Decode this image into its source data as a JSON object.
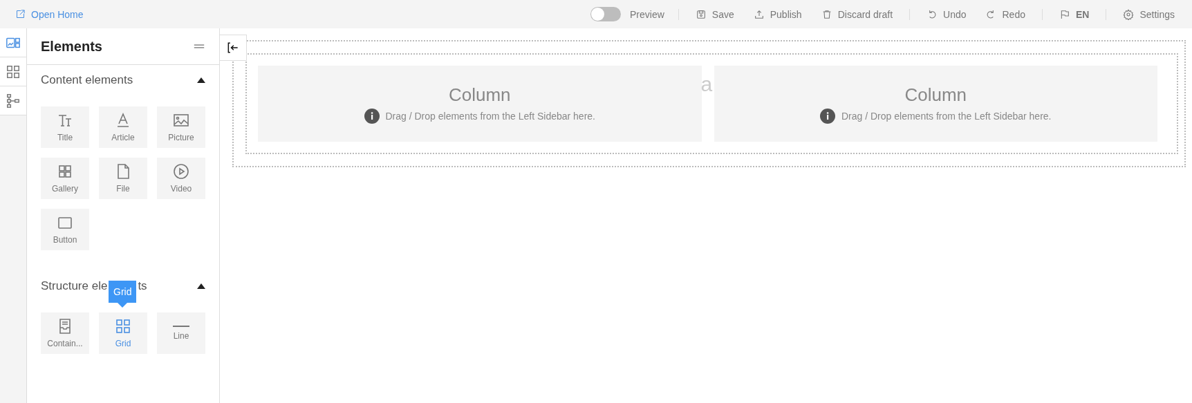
{
  "header": {
    "open_home": "Open Home",
    "groups": [
      [
        {
          "kind": "toggle",
          "label": "Preview",
          "on": false
        }
      ],
      [
        {
          "kind": "save",
          "label": "Save"
        },
        {
          "kind": "publish",
          "label": "Publish"
        },
        {
          "kind": "trash",
          "label": "Discard draft"
        }
      ],
      [
        {
          "kind": "undo",
          "label": "Undo"
        },
        {
          "kind": "redo",
          "label": "Redo"
        }
      ],
      [
        {
          "kind": "flag",
          "label": "EN"
        }
      ],
      [
        {
          "kind": "gear",
          "label": "Settings"
        }
      ]
    ]
  },
  "rail": [
    {
      "kind": "elements",
      "selected": true
    },
    {
      "kind": "grid",
      "selected": false
    },
    {
      "kind": "tree",
      "selected": false
    }
  ],
  "sidebar": {
    "title": "Elements",
    "sections": [
      {
        "title_parts": [
          "Content elements"
        ],
        "expanded": true,
        "items": [
          {
            "kind": "title",
            "label": "Title",
            "selected": false
          },
          {
            "kind": "article",
            "label": "Article",
            "selected": false
          },
          {
            "kind": "picture",
            "label": "Picture",
            "selected": false
          },
          {
            "kind": "gallery",
            "label": "Gallery",
            "selected": false
          },
          {
            "kind": "file",
            "label": "File",
            "selected": false
          },
          {
            "kind": "video",
            "label": "Video",
            "selected": false
          },
          {
            "kind": "button",
            "label": "Button",
            "selected": false
          }
        ]
      },
      {
        "title_parts": [
          "Structure ele",
          "ts"
        ],
        "expanded": true,
        "items": [
          {
            "kind": "container",
            "label": "Contain...",
            "selected": false
          },
          {
            "kind": "grid",
            "label": "Grid",
            "selected": true,
            "tooltip": "Grid"
          },
          {
            "kind": "line",
            "label": "Line",
            "selected": false
          }
        ]
      }
    ]
  },
  "canvas": {
    "background_text": "a",
    "columns": [
      {
        "title": "Column",
        "hint": "Drag / Drop elements from the Left Sidebar here."
      },
      {
        "title": "Column",
        "hint": "Drag / Drop elements from the Left Sidebar here."
      }
    ]
  }
}
